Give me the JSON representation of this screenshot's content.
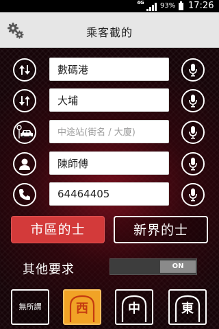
{
  "status_bar": {
    "network": "4G",
    "battery": "93%",
    "time": "17:26"
  },
  "header": {
    "title": "乘客截的",
    "settings_icon": "gear-icon"
  },
  "form": {
    "pickup": {
      "value": "數碼港",
      "left_icon": "up-down-arrows-icon",
      "right_icon": "microphone-icon"
    },
    "destination": {
      "value": "大埔",
      "left_icon": "down-up-arrows-icon",
      "right_icon": "microphone-icon"
    },
    "stopover": {
      "value": "",
      "placeholder": "中途站(街名 / 大廈)",
      "left_icon": "taxi-stop-icon",
      "right_icon": "microphone-icon"
    },
    "name": {
      "value": "陳師傅",
      "left_icon": "person-icon",
      "right_icon": "microphone-icon"
    },
    "phone": {
      "value": "64464405",
      "left_icon": "phone-icon",
      "right_icon": "microphone-icon"
    }
  },
  "taxi_type": {
    "urban": "市區的士",
    "nt": "新界的士",
    "selected": "urban"
  },
  "other": {
    "label": "其他要求",
    "toggle_text": "ON"
  },
  "tunnels": {
    "any": "無所謂",
    "west": "西",
    "middle": "中",
    "east": "東",
    "selected": "west"
  },
  "colors": {
    "accent_red": "#d33a3a",
    "accent_orange": "#f1a326",
    "header_bg": "#e6e6e6"
  }
}
